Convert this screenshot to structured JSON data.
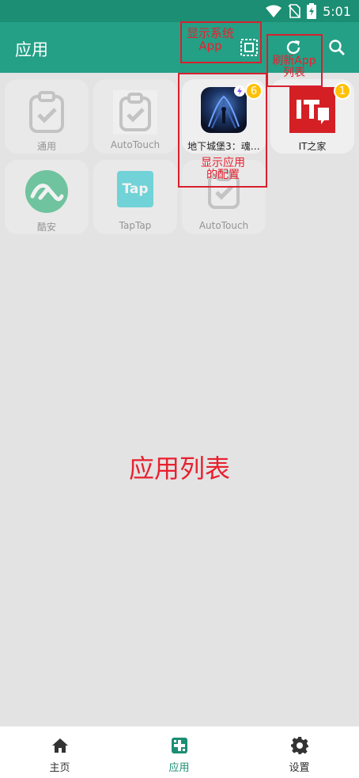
{
  "status_bar": {
    "time": "5:01"
  },
  "app_bar": {
    "title": "应用"
  },
  "apps": [
    {
      "label": "通用",
      "icon": "clipboard-check-icon",
      "enabled": false
    },
    {
      "label": "AutoTouch",
      "icon": "clipboard-check-icon",
      "enabled": false
    },
    {
      "label": "地下城堡3：魂…",
      "icon": "dungeon-game-icon",
      "enabled": true,
      "badge": "6"
    },
    {
      "label": "IT之家",
      "icon": "ithome-logo-icon",
      "enabled": true,
      "badge": "1"
    },
    {
      "label": "酷安",
      "icon": "coolapk-logo-icon",
      "enabled": false
    },
    {
      "label": "TapTap",
      "icon": "taptap-logo-icon",
      "enabled": false,
      "logo_text": "Tap"
    },
    {
      "label": "AutoTouch",
      "icon": "clipboard-check-icon",
      "enabled": false
    }
  ],
  "annotations": {
    "show_system_app_line1": "显示系统",
    "show_system_app_line2": "App",
    "refresh_line1": "刷新App",
    "refresh_line2": "列表",
    "app_config_line1": "显示应用",
    "app_config_line2": "的配置",
    "app_list": "应用列表"
  },
  "bottom_nav": [
    {
      "label": "主页",
      "icon": "home-icon",
      "active": false
    },
    {
      "label": "应用",
      "icon": "apps-icon",
      "active": true
    },
    {
      "label": "设置",
      "icon": "gear-icon",
      "active": false
    }
  ],
  "colors": {
    "status_bar": "#1b8e73",
    "app_bar": "#24a086",
    "accent": "#1b8e73",
    "badge": "#ffc107",
    "annotation": "#e8202f"
  }
}
